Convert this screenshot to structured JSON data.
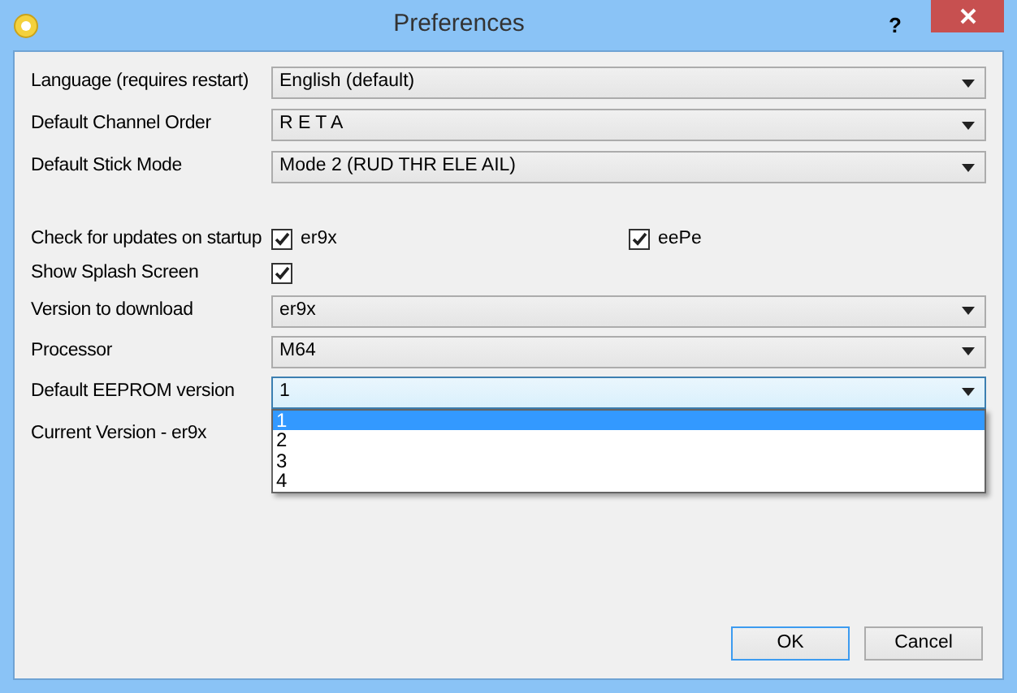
{
  "window": {
    "title": "Preferences",
    "help": "?"
  },
  "groups": [
    [
      {
        "kind": "combo",
        "label": "Language (requires restart)",
        "value": "English (default)"
      },
      {
        "kind": "combo",
        "label": "Default Channel Order",
        "value": "R E T A"
      },
      {
        "kind": "combo",
        "label": "Default Stick Mode",
        "value": "Mode 2 (RUD THR ELE AIL)"
      }
    ],
    [
      {
        "kind": "checks",
        "label": "Check for updates on startup",
        "checks": [
          {
            "label": "er9x",
            "checked": true
          },
          {
            "label": "eePe",
            "checked": true
          }
        ]
      },
      {
        "kind": "checkbox",
        "label": "Show Splash Screen",
        "checked": true
      },
      {
        "kind": "combo",
        "label": "Version to download",
        "value": "er9x"
      },
      {
        "kind": "combo",
        "label": "Processor",
        "value": "M64"
      },
      {
        "kind": "combo",
        "label": "Default EEPROM version",
        "value": "1",
        "open": true,
        "options": [
          {
            "label": "1",
            "selected": true
          },
          {
            "label": "2",
            "selected": false
          },
          {
            "label": "3",
            "selected": false
          },
          {
            "label": "4",
            "selected": false
          }
        ]
      },
      {
        "kind": "label",
        "label": "Current Version - er9x"
      }
    ]
  ],
  "buttons": [
    {
      "label": "OK",
      "default": true
    },
    {
      "label": "Cancel",
      "default": false
    }
  ]
}
